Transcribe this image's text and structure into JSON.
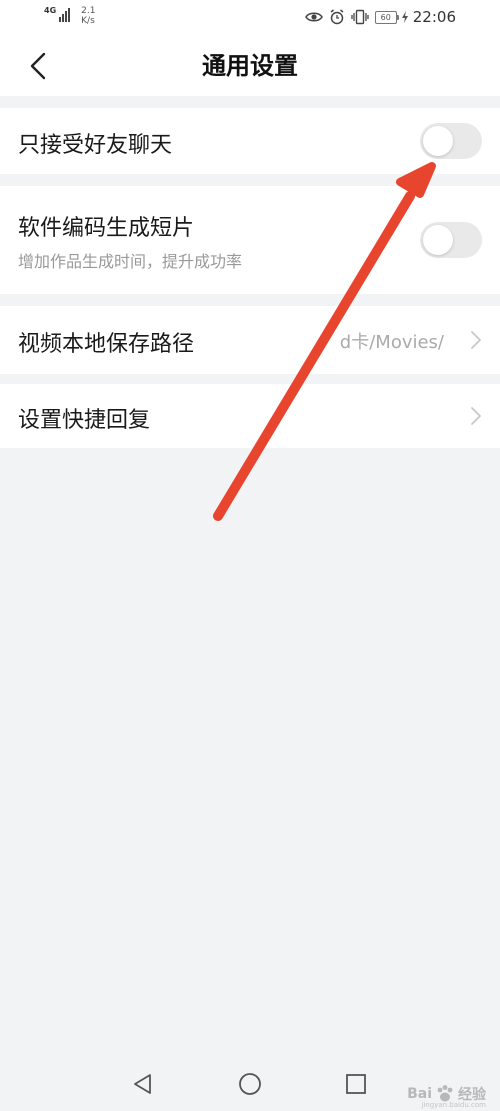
{
  "status_bar": {
    "network": "4G",
    "speed_value": "2.1",
    "speed_unit": "K/s",
    "battery": "60",
    "time": "22:06"
  },
  "header": {
    "title": "通用设置"
  },
  "settings": {
    "friends_only_chat": {
      "label": "只接受好友聊天",
      "enabled": false
    },
    "software_encoding": {
      "label": "软件编码生成短片",
      "description": "增加作品生成时间，提升成功率",
      "enabled": false
    },
    "video_save_path": {
      "label": "视频本地保存路径",
      "value": "d卡/Movies/"
    },
    "quick_reply": {
      "label": "设置快捷回复"
    }
  },
  "watermark": {
    "brand_prefix": "Bai",
    "brand_suffix": "经验",
    "site": "jingyan.baidu.com"
  },
  "colors": {
    "annotation_arrow": "#e8452f",
    "toggle_off": "#e9e9ea",
    "background": "#f2f3f5"
  }
}
